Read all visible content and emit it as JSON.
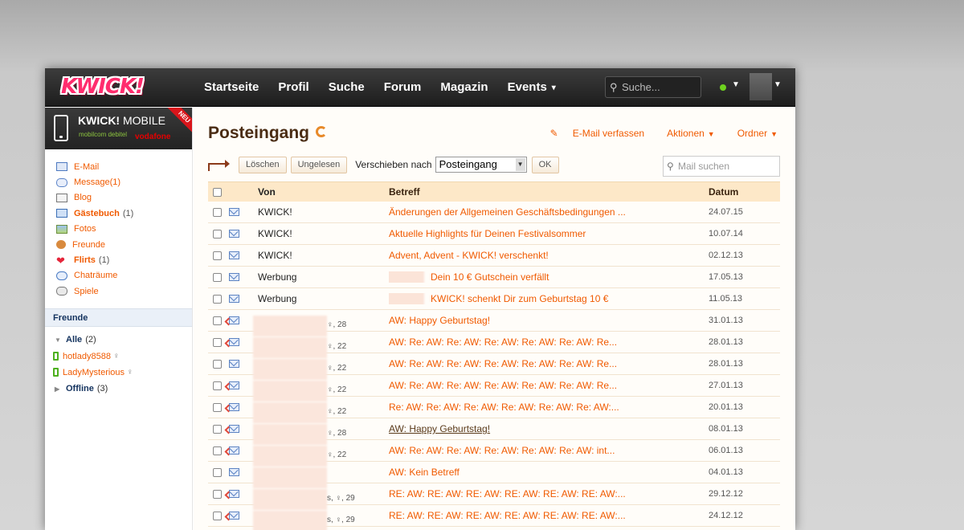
{
  "logo": {
    "text": "KWICK!"
  },
  "nav": {
    "items": [
      "Startseite",
      "Profil",
      "Suche",
      "Forum",
      "Magazin",
      "Events"
    ],
    "events_caret": "▾",
    "search_placeholder": "Suche..."
  },
  "sidebar": {
    "banner": {
      "title_bold": "KWICK!",
      "title_thin": " MOBILE",
      "partner1": "mobilcom debitel",
      "partner2": "vodafone",
      "ribbon": "NEU"
    },
    "menu": [
      {
        "label": "E-Mail",
        "count": "",
        "bold": false,
        "icon": "mail-icon"
      },
      {
        "label": "Message",
        "count": " (1)",
        "bold": false,
        "icon": "message-icon"
      },
      {
        "label": "Blog",
        "count": "",
        "bold": false,
        "icon": "blog-icon"
      },
      {
        "label": "Gästebuch",
        "count": "(1)",
        "bold": true,
        "icon": "guestbook-icon"
      },
      {
        "label": "Fotos",
        "count": "",
        "bold": false,
        "icon": "photo-icon"
      },
      {
        "label": "Freunde",
        "count": "",
        "bold": false,
        "icon": "friends-icon"
      },
      {
        "label": "Flirts",
        "count": "(1)",
        "bold": true,
        "icon": "heart-icon"
      },
      {
        "label": "Chaträume",
        "count": "",
        "bold": false,
        "icon": "chat-icon"
      },
      {
        "label": "Spiele",
        "count": "",
        "bold": false,
        "icon": "gamepad-icon"
      }
    ],
    "friends_heading": "Freunde",
    "group_all": {
      "label": "Alle",
      "count": "(2)"
    },
    "friends": [
      "hotlady8588",
      "LadyMysterious"
    ],
    "group_offline": {
      "label": "Offline",
      "count": "(3)"
    }
  },
  "main": {
    "title": "Posteingang",
    "compose": "E-Mail verfassen",
    "actions": "Aktionen",
    "folders": "Ordner",
    "toolbar": {
      "delete": "Löschen",
      "unread": "Ungelesen",
      "move_label": "Verschieben nach",
      "move_value": "Posteingang",
      "ok": "OK"
    },
    "mail_search_placeholder": "Mail suchen",
    "columns": {
      "from": "Von",
      "subject": "Betreff",
      "date": "Datum"
    },
    "rows": [
      {
        "from": "KWICK!",
        "age": "",
        "subject": "Änderungen der Allgemeinen Geschäftsbedingungen ...",
        "date": "24.07.15",
        "type": "normal",
        "replied": false
      },
      {
        "from": "KWICK!",
        "age": "",
        "subject": "Aktuelle Highlights für Deinen Festivalsommer",
        "date": "10.07.14",
        "type": "normal",
        "replied": false
      },
      {
        "from": "KWICK!",
        "age": "",
        "subject": "Advent, Advent - KWICK! verschenkt!",
        "date": "02.12.13",
        "type": "normal",
        "replied": false
      },
      {
        "from": "Werbung",
        "age": "",
        "subject": "Dein 10 € Gutschein verfällt",
        "date": "17.05.13",
        "type": "ad",
        "replied": false
      },
      {
        "from": "Werbung",
        "age": "",
        "subject": "KWICK! schenkt Dir zum Geburtstag 10 €",
        "date": "11.05.13",
        "type": "ad",
        "replied": false
      },
      {
        "from": "",
        "age": "♀, 28",
        "subject": "AW: Happy Geburtstag!",
        "date": "31.01.13",
        "type": "blur",
        "replied": true
      },
      {
        "from": "",
        "age": "♀, 22",
        "subject": "AW: Re: AW: Re: AW: Re: AW: Re: AW: Re: AW: Re...",
        "date": "28.01.13",
        "type": "blur",
        "replied": true
      },
      {
        "from": "",
        "age": "♀, 22",
        "subject": "AW: Re: AW: Re: AW: Re: AW: Re: AW: Re: AW: Re...",
        "date": "28.01.13",
        "type": "blur",
        "replied": false
      },
      {
        "from": "",
        "age": "♀, 22",
        "subject": "AW: Re: AW: Re: AW: Re: AW: Re: AW: Re: AW: Re...",
        "date": "27.01.13",
        "type": "blur",
        "replied": true
      },
      {
        "from": "",
        "age": "♀, 22",
        "subject": "Re: AW: Re: AW: Re: AW: Re: AW: Re: AW: Re: AW:...",
        "date": "20.01.13",
        "type": "blur",
        "replied": true
      },
      {
        "from": "",
        "age": "♀, 28",
        "subject": "AW: Happy Geburtstag!",
        "date": "08.01.13",
        "type": "blur-unread",
        "replied": true
      },
      {
        "from": "",
        "age": "♀, 22",
        "subject": "AW: Re: AW: Re: AW: Re: AW: Re: AW: Re: AW: int...",
        "date": "06.01.13",
        "type": "blur",
        "replied": true
      },
      {
        "from": "",
        "age": "",
        "subject": "AW: Kein Betreff",
        "date": "04.01.13",
        "type": "blur",
        "replied": false
      },
      {
        "from": "",
        "age": "s, ♀, 29",
        "subject": "RE: AW: RE: AW: RE: AW: RE: AW: RE: AW: RE: AW:...",
        "date": "29.12.12",
        "type": "blur",
        "replied": true
      },
      {
        "from": "",
        "age": "s, ♀, 29",
        "subject": "RE: AW: RE: AW: RE: AW: RE: AW: RE: AW: RE: AW:...",
        "date": "24.12.12",
        "type": "blur",
        "replied": true
      }
    ]
  },
  "colors": {
    "accent": "#f05a00",
    "header_row": "#fde8c8",
    "nav_bg": "#2a2a2a",
    "online": "#6ed11f"
  }
}
